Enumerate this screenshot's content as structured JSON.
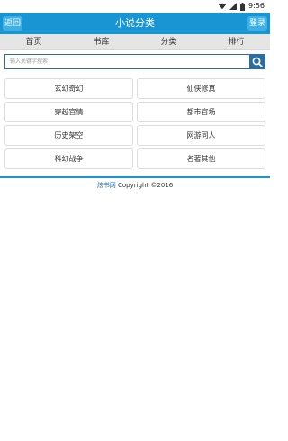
{
  "status_bar": {
    "time": "9:56"
  },
  "header": {
    "back_label": "返回",
    "title": "小说分类",
    "login_label": "登录"
  },
  "nav": [
    {
      "label": "首页"
    },
    {
      "label": "书库"
    },
    {
      "label": "分类"
    },
    {
      "label": "排行"
    }
  ],
  "search": {
    "placeholder": "输入关键字搜索"
  },
  "categories": [
    {
      "label": "玄幻奇幻"
    },
    {
      "label": "仙侠修真"
    },
    {
      "label": "穿越宫情"
    },
    {
      "label": "都市官场"
    },
    {
      "label": "历史架空"
    },
    {
      "label": "网游同人"
    },
    {
      "label": "科幻战争"
    },
    {
      "label": "名著其他"
    }
  ],
  "footer": {
    "site_name": "炫书网",
    "copyright": " Copyright ©2016"
  },
  "colors": {
    "header": "#1a95d3",
    "header_button": "#3fb0e6",
    "search_button": "#2b6fa1",
    "nav_bg": "#e5e5e5"
  }
}
